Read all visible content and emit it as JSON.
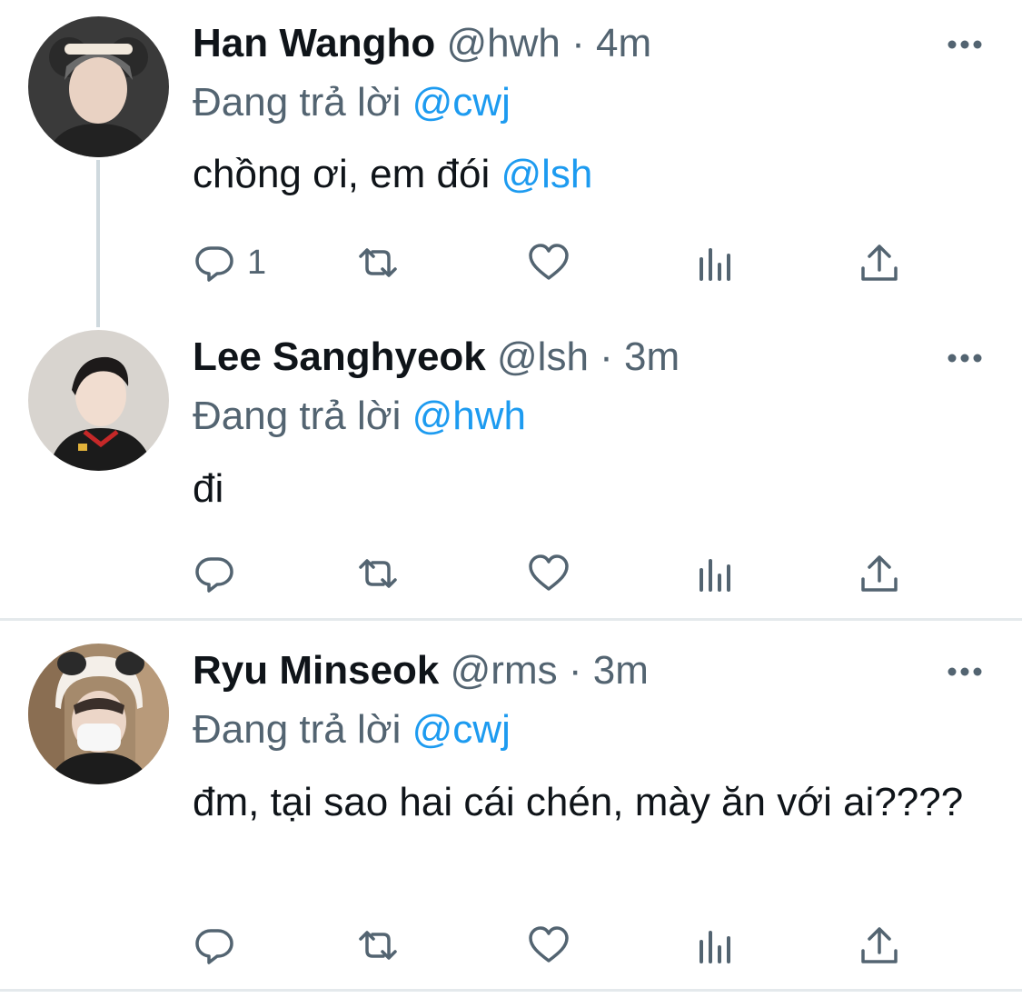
{
  "tweets": [
    {
      "name": "Han Wangho",
      "handle": "@hwh",
      "sep": " · ",
      "time": "4m",
      "replying_prefix": "Đang trả lời ",
      "replying_to": "@cwj",
      "text_main": "chồng ơi, em đói ",
      "text_mention": "@lsh",
      "reply_count": "1",
      "avatar_colors": {
        "bg": "#3a3a3a",
        "skin": "#e9d2c3",
        "hair": "#6b6b6b"
      }
    },
    {
      "name": "Lee Sanghyeok",
      "handle": "@lsh",
      "sep": " · ",
      "time": "3m",
      "replying_prefix": "Đang trả lời ",
      "replying_to": "@hwh",
      "text_main": "đi",
      "reply_count": "",
      "avatar_colors": {
        "bg": "#d8d4cf",
        "skin": "#f1ddd0",
        "hair": "#1d1a1a"
      }
    },
    {
      "name": "Ryu Minseok",
      "handle": "@rms",
      "sep": " · ",
      "time": "3m",
      "replying_prefix": "Đang trả lời ",
      "replying_to": "@cwj",
      "text_main": "đm, tại sao hai cái chén, mày ăn với ai????",
      "reply_count": "",
      "avatar_colors": {
        "bg": "#a58a6c",
        "skin": "#ecd6c8",
        "hair": "#f4efe9"
      }
    }
  ],
  "icons": {
    "reply": "reply-icon",
    "retweet": "retweet-icon",
    "like": "heart-icon",
    "views": "views-icon",
    "share": "share-icon",
    "more": "more-icon"
  },
  "colors": {
    "accent": "#1d9bf0",
    "muted": "#536471",
    "text": "#0f1419"
  }
}
